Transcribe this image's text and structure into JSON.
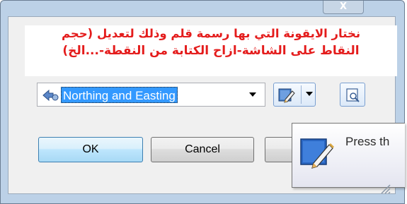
{
  "annotation": {
    "line1": "نختار الايقونة التي بها رسمة قلم وذلك لتعديل (حجم",
    "line2": "النقاط على الشاشة-ازاح الكتابة من النقطة-...الخ)"
  },
  "window": {
    "close_glyph": "X"
  },
  "coordinate_format": {
    "selected_value": "Northing and Easting"
  },
  "buttons": {
    "ok_label": "OK",
    "cancel_label": "Cancel",
    "third_label": ""
  },
  "tooltip": {
    "text": "Press th"
  },
  "icons": {
    "format_icon": "coordinate-format-icon",
    "edit_icon": "pen-edit-icon",
    "preview_icon": "magnify-preview-icon",
    "tooltip_icon": "pen-edit-icon",
    "grip_icon": "resize-grip-icon"
  },
  "colors": {
    "annotation_text": "#e41c1c",
    "selection": "#3399ff",
    "ok_button_border": "#3c7fb1",
    "frame": "#bcd1e7"
  }
}
